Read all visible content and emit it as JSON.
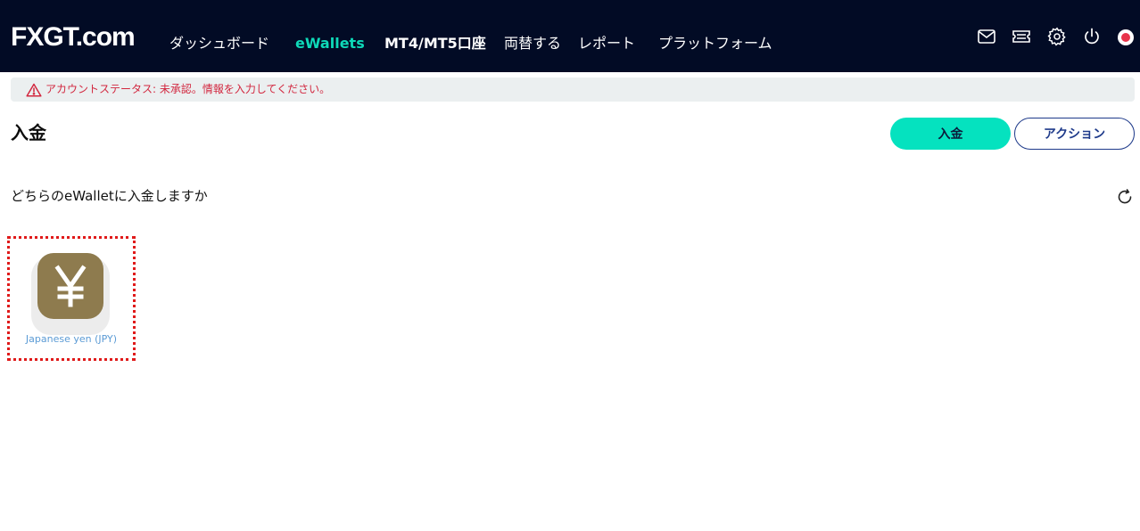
{
  "header": {
    "logo_fx": "FX",
    "logo_gt": "GT",
    "logo_dot": ".com",
    "nav": [
      {
        "label": "ダッシュボード"
      },
      {
        "label": "eWallets"
      },
      {
        "label": "MT4/MT5口座"
      },
      {
        "label": "両替する"
      },
      {
        "label": "レポート"
      },
      {
        "label": "プラットフォーム"
      }
    ],
    "icons": [
      "mail-icon",
      "ticket-icon",
      "gear-icon",
      "power-icon",
      "japan-flag-icon"
    ]
  },
  "alert": {
    "message": "アカウントステータス: 未承認。情報を入力してください。",
    "icon": "warning-icon",
    "color": "#d2273f"
  },
  "page": {
    "title": "入金",
    "deposit_label": "入金",
    "action_label": "アクション",
    "question": "どちらのeWalletに入金しますか"
  },
  "wallets": [
    {
      "label": "Japanese yen (JPY)",
      "icon": "yen-icon",
      "color": "#8e7b4e"
    }
  ],
  "colors": {
    "nav_bg": "#020b25",
    "accent": "#05e2bf",
    "active_nav": "#0ed9b8",
    "action_border": "#1e3a8a"
  }
}
